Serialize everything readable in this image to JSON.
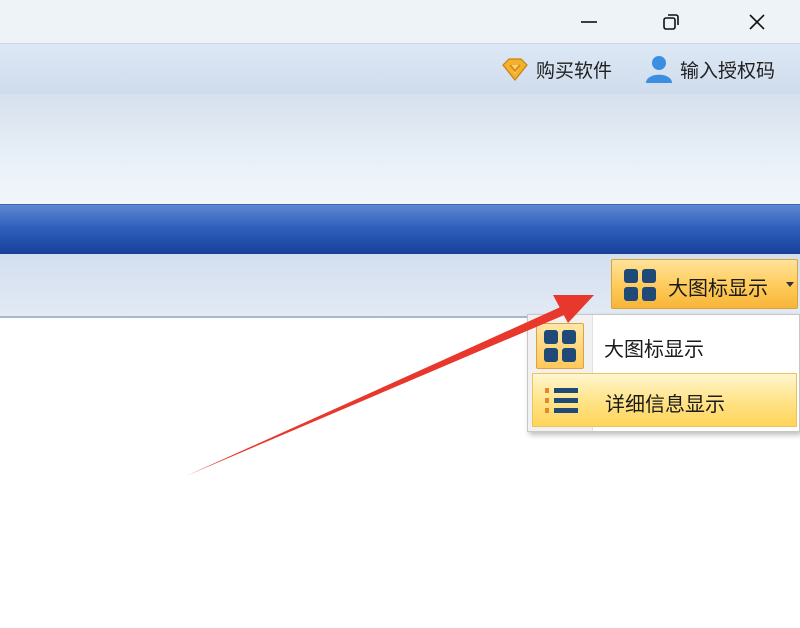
{
  "window_controls": {
    "minimize_icon": "minimize-icon",
    "restore_icon": "restore-icon",
    "close_icon": "close-icon"
  },
  "header_links": [
    {
      "label": "购买软件",
      "icon": "diamond-icon"
    },
    {
      "label": "输入授权码",
      "icon": "user-icon"
    }
  ],
  "view_button": {
    "label": "大图标显示",
    "icon": "grid-icon"
  },
  "view_menu": {
    "items": [
      {
        "label": "大图标显示",
        "icon": "grid-icon",
        "selected": false
      },
      {
        "label": "详细信息显示",
        "icon": "list-icon",
        "selected": true
      }
    ]
  },
  "colors": {
    "accent_orange": "#ffcd5f",
    "blue_band": "#2f5fbd",
    "annotation_arrow": "#e8372c"
  }
}
